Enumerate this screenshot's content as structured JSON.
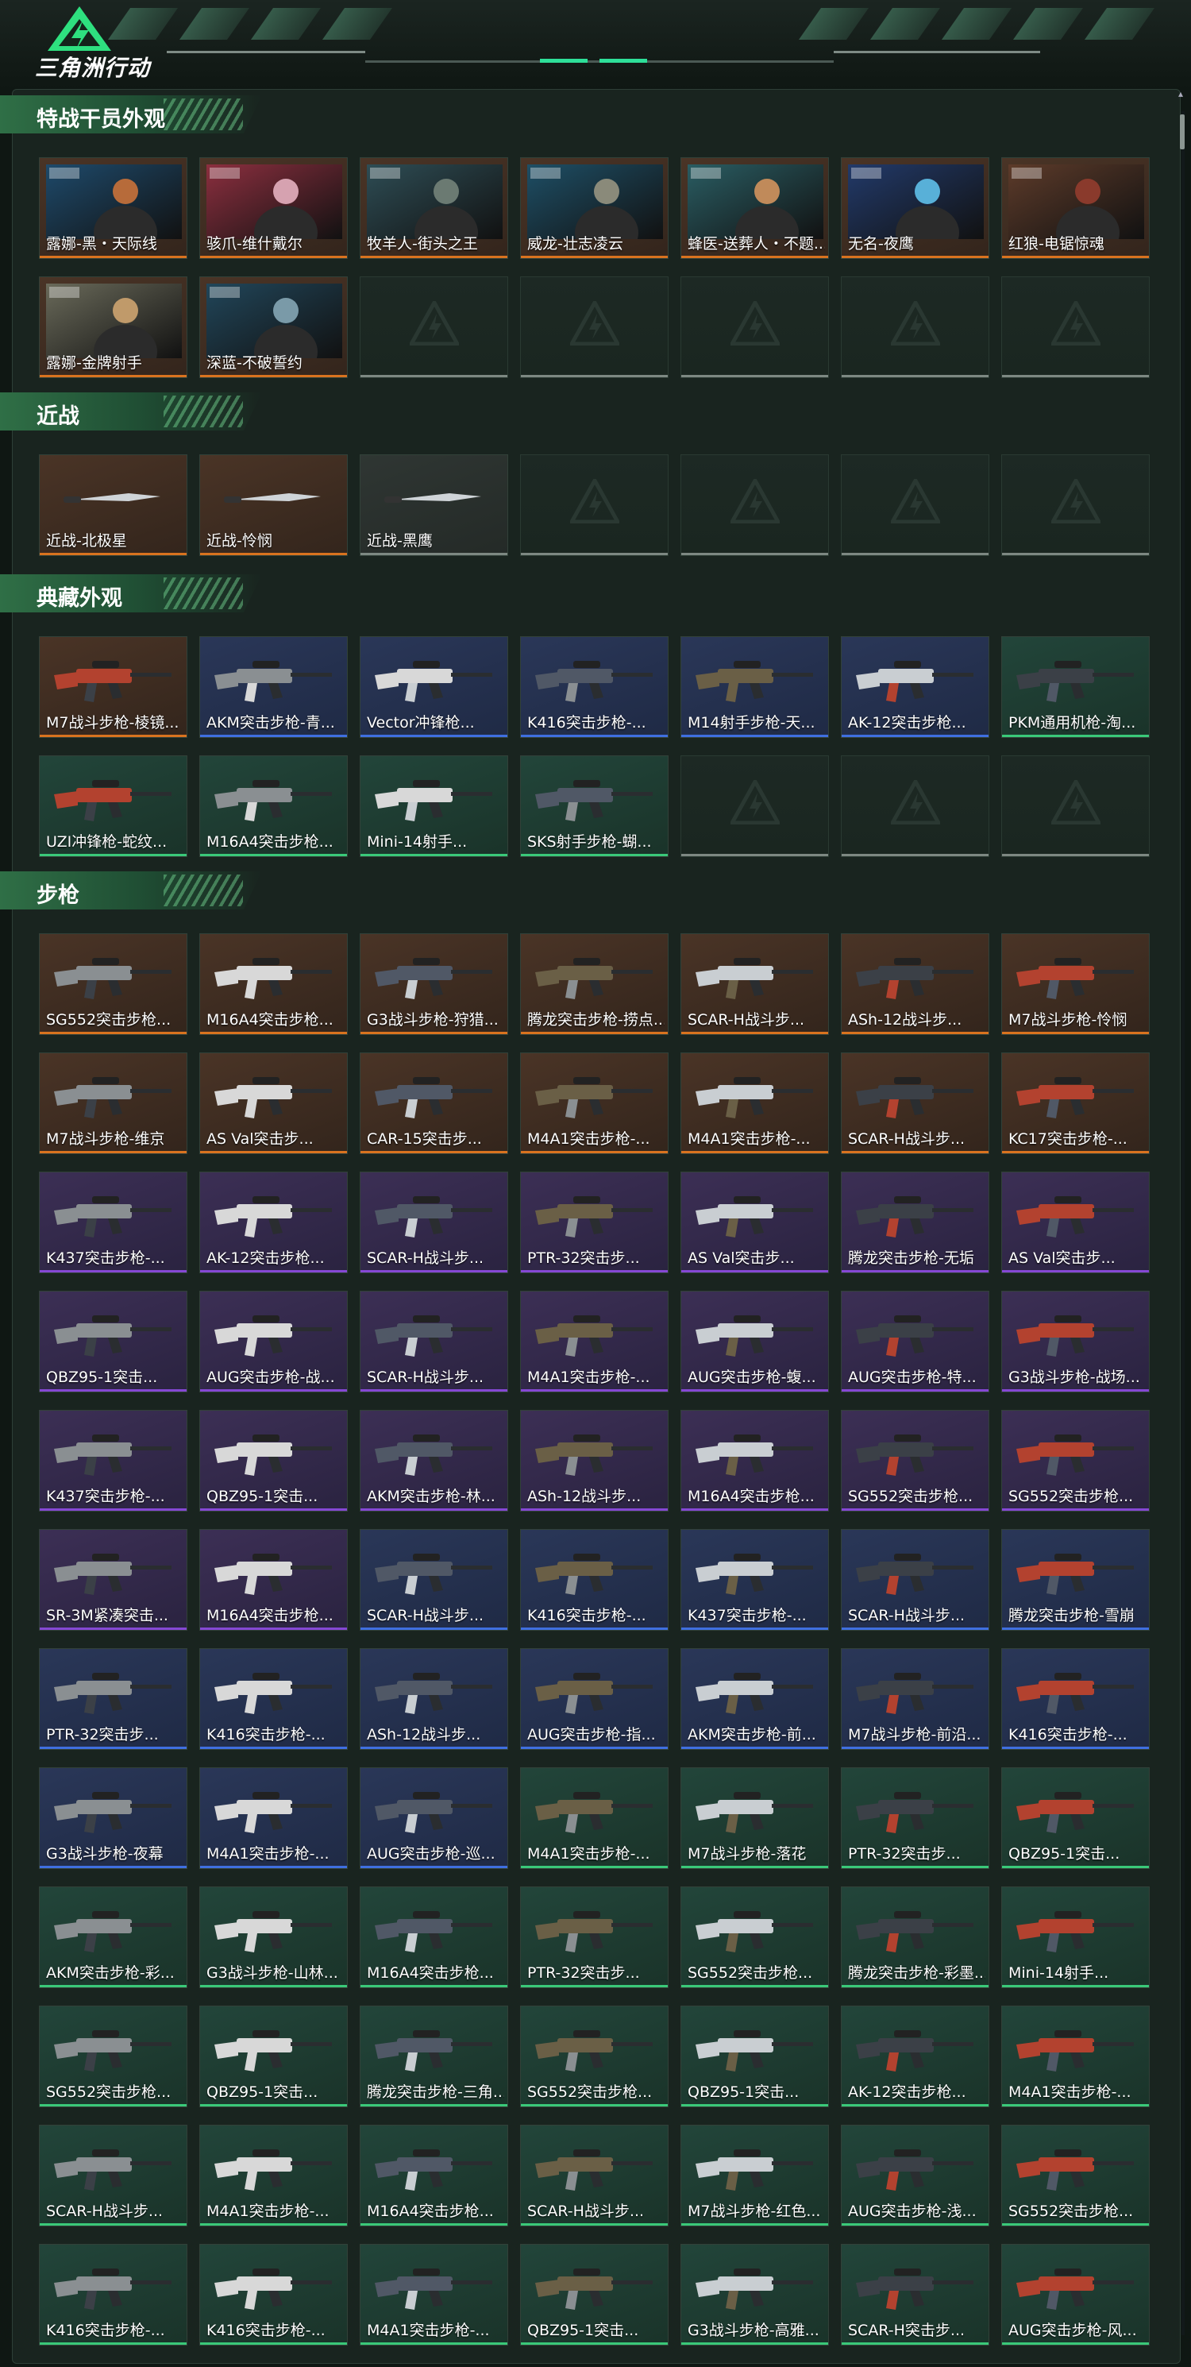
{
  "app": {
    "logo_text": "三角洲行动"
  },
  "colors": {
    "orange": "#d9731f",
    "purple": "#8548d4",
    "blue": "#3f6fe0",
    "green": "#3ac979",
    "grey": "#7d8882"
  },
  "sections": [
    {
      "title": "特战干员外观",
      "items": [
        {
          "name": "露娜-黑・天际线",
          "rarity": "orange",
          "icon": "operator-portrait"
        },
        {
          "name": "骇爪-维什戴尔",
          "rarity": "orange",
          "icon": "operator-portrait"
        },
        {
          "name": "牧羊人-街头之王",
          "rarity": "orange",
          "icon": "operator-portrait"
        },
        {
          "name": "威龙-壮志凌云",
          "rarity": "orange",
          "icon": "operator-portrait"
        },
        {
          "name": "蜂医-送葬人・不题...",
          "rarity": "orange",
          "icon": "operator-portrait"
        },
        {
          "name": "无名-夜鹰",
          "rarity": "orange",
          "icon": "operator-portrait"
        },
        {
          "name": "红狼-电锯惊魂",
          "rarity": "orange",
          "icon": "operator-portrait"
        },
        {
          "name": "露娜-金牌射手",
          "rarity": "orange",
          "icon": "operator-portrait"
        },
        {
          "name": "深蓝-不破誓约",
          "rarity": "orange",
          "icon": "operator-portrait"
        }
      ]
    },
    {
      "title": "近战",
      "items": [
        {
          "name": "近战-北极星",
          "rarity": "orange",
          "icon": "knife"
        },
        {
          "name": "近战-怜悯",
          "rarity": "orange",
          "icon": "knife"
        },
        {
          "name": "近战-黑鹰",
          "rarity": "grey",
          "icon": "knife"
        }
      ]
    },
    {
      "title": "典藏外观",
      "items": [
        {
          "name": "M7战斗步枪-棱镜...",
          "rarity": "orange",
          "icon": "rifle"
        },
        {
          "name": "AKM突击步枪-青...",
          "rarity": "blue",
          "icon": "rifle"
        },
        {
          "name": "Vector冲锋枪...",
          "rarity": "blue",
          "icon": "smg"
        },
        {
          "name": "K416突击步枪-...",
          "rarity": "blue",
          "icon": "rifle"
        },
        {
          "name": "M14射手步枪-天...",
          "rarity": "blue",
          "icon": "rifle"
        },
        {
          "name": "AK-12突击步枪...",
          "rarity": "blue",
          "icon": "rifle"
        },
        {
          "name": "PKM通用机枪-淘...",
          "rarity": "green",
          "icon": "rifle"
        },
        {
          "name": "UZI冲锋枪-蛇纹...",
          "rarity": "green",
          "icon": "smg"
        },
        {
          "name": "M16A4突击步枪...",
          "rarity": "green",
          "icon": "rifle"
        },
        {
          "name": "Mini-14射手...",
          "rarity": "green",
          "icon": "rifle"
        },
        {
          "name": "SKS射手步枪-蝴...",
          "rarity": "green",
          "icon": "rifle"
        }
      ]
    },
    {
      "title": "步枪",
      "items": [
        {
          "name": "SG552突击步枪...",
          "rarity": "orange",
          "icon": "rifle"
        },
        {
          "name": "M16A4突击步枪...",
          "rarity": "orange",
          "icon": "rifle"
        },
        {
          "name": "G3战斗步枪-狩猎...",
          "rarity": "orange",
          "icon": "rifle"
        },
        {
          "name": "腾龙突击步枪-捞点...",
          "rarity": "orange",
          "icon": "rifle"
        },
        {
          "name": "SCAR-H战斗步...",
          "rarity": "orange",
          "icon": "rifle"
        },
        {
          "name": "ASh-12战斗步...",
          "rarity": "orange",
          "icon": "rifle"
        },
        {
          "name": "M7战斗步枪-怜悯",
          "rarity": "orange",
          "icon": "rifle"
        },
        {
          "name": "M7战斗步枪-维京",
          "rarity": "orange",
          "icon": "rifle"
        },
        {
          "name": "AS Val突击步...",
          "rarity": "orange",
          "icon": "rifle"
        },
        {
          "name": "CAR-15突击步...",
          "rarity": "orange",
          "icon": "rifle"
        },
        {
          "name": "M4A1突击步枪-...",
          "rarity": "orange",
          "icon": "rifle"
        },
        {
          "name": "M4A1突击步枪-...",
          "rarity": "orange",
          "icon": "rifle"
        },
        {
          "name": "SCAR-H战斗步...",
          "rarity": "orange",
          "icon": "rifle"
        },
        {
          "name": "KC17突击步枪-...",
          "rarity": "orange",
          "icon": "rifle"
        },
        {
          "name": "K437突击步枪-...",
          "rarity": "purple",
          "icon": "rifle"
        },
        {
          "name": "AK-12突击步枪...",
          "rarity": "purple",
          "icon": "rifle"
        },
        {
          "name": "SCAR-H战斗步...",
          "rarity": "purple",
          "icon": "rifle"
        },
        {
          "name": "PTR-32突击步...",
          "rarity": "purple",
          "icon": "rifle"
        },
        {
          "name": "AS Val突击步...",
          "rarity": "purple",
          "icon": "rifle"
        },
        {
          "name": "腾龙突击步枪-无垢",
          "rarity": "purple",
          "icon": "rifle"
        },
        {
          "name": "AS Val突击步...",
          "rarity": "purple",
          "icon": "rifle"
        },
        {
          "name": "QBZ95-1突击...",
          "rarity": "purple",
          "icon": "rifle"
        },
        {
          "name": "AUG突击步枪-战...",
          "rarity": "purple",
          "icon": "rifle"
        },
        {
          "name": "SCAR-H战斗步...",
          "rarity": "purple",
          "icon": "rifle"
        },
        {
          "name": "M4A1突击步枪-...",
          "rarity": "purple",
          "icon": "rifle"
        },
        {
          "name": "AUG突击步枪-蝮...",
          "rarity": "purple",
          "icon": "rifle"
        },
        {
          "name": "AUG突击步枪-特...",
          "rarity": "purple",
          "icon": "rifle"
        },
        {
          "name": "G3战斗步枪-战场...",
          "rarity": "purple",
          "icon": "rifle"
        },
        {
          "name": "K437突击步枪-...",
          "rarity": "purple",
          "icon": "rifle"
        },
        {
          "name": "QBZ95-1突击...",
          "rarity": "purple",
          "icon": "rifle"
        },
        {
          "name": "AKM突击步枪-林...",
          "rarity": "purple",
          "icon": "rifle"
        },
        {
          "name": "ASh-12战斗步...",
          "rarity": "purple",
          "icon": "rifle"
        },
        {
          "name": "M16A4突击步枪...",
          "rarity": "purple",
          "icon": "rifle"
        },
        {
          "name": "SG552突击步枪...",
          "rarity": "purple",
          "icon": "rifle"
        },
        {
          "name": "SG552突击步枪...",
          "rarity": "purple",
          "icon": "rifle"
        },
        {
          "name": "SR-3M紧凑突击...",
          "rarity": "purple",
          "icon": "rifle"
        },
        {
          "name": "M16A4突击步枪...",
          "rarity": "purple",
          "icon": "rifle"
        },
        {
          "name": "SCAR-H战斗步...",
          "rarity": "blue",
          "icon": "rifle"
        },
        {
          "name": "K416突击步枪-...",
          "rarity": "blue",
          "icon": "rifle"
        },
        {
          "name": "K437突击步枪-...",
          "rarity": "blue",
          "icon": "rifle"
        },
        {
          "name": "SCAR-H战斗步...",
          "rarity": "blue",
          "icon": "rifle"
        },
        {
          "name": "腾龙突击步枪-雪崩",
          "rarity": "blue",
          "icon": "rifle"
        },
        {
          "name": "PTR-32突击步...",
          "rarity": "blue",
          "icon": "rifle"
        },
        {
          "name": "K416突击步枪-...",
          "rarity": "blue",
          "icon": "rifle"
        },
        {
          "name": "ASh-12战斗步...",
          "rarity": "blue",
          "icon": "rifle"
        },
        {
          "name": "AUG突击步枪-指...",
          "rarity": "blue",
          "icon": "rifle"
        },
        {
          "name": "AKM突击步枪-前...",
          "rarity": "blue",
          "icon": "rifle"
        },
        {
          "name": "M7战斗步枪-前沿...",
          "rarity": "blue",
          "icon": "rifle"
        },
        {
          "name": "K416突击步枪-...",
          "rarity": "blue",
          "icon": "rifle"
        },
        {
          "name": "G3战斗步枪-夜幕",
          "rarity": "blue",
          "icon": "rifle"
        },
        {
          "name": "M4A1突击步枪-...",
          "rarity": "blue",
          "icon": "rifle"
        },
        {
          "name": "AUG突击步枪-巡...",
          "rarity": "blue",
          "icon": "rifle"
        },
        {
          "name": "M4A1突击步枪-...",
          "rarity": "green",
          "icon": "rifle"
        },
        {
          "name": "M7战斗步枪-落花",
          "rarity": "green",
          "icon": "rifle"
        },
        {
          "name": "PTR-32突击步...",
          "rarity": "green",
          "icon": "rifle"
        },
        {
          "name": "QBZ95-1突击...",
          "rarity": "green",
          "icon": "rifle"
        },
        {
          "name": "AKM突击步枪-彩...",
          "rarity": "green",
          "icon": "rifle"
        },
        {
          "name": "G3战斗步枪-山林...",
          "rarity": "green",
          "icon": "rifle"
        },
        {
          "name": "M16A4突击步枪...",
          "rarity": "green",
          "icon": "rifle"
        },
        {
          "name": "PTR-32突击步...",
          "rarity": "green",
          "icon": "rifle"
        },
        {
          "name": "SG552突击步枪...",
          "rarity": "green",
          "icon": "rifle"
        },
        {
          "name": "腾龙突击步枪-彩墨...",
          "rarity": "green",
          "icon": "rifle"
        },
        {
          "name": "Mini-14射手...",
          "rarity": "green",
          "icon": "rifle"
        },
        {
          "name": "SG552突击步枪...",
          "rarity": "green",
          "icon": "rifle"
        },
        {
          "name": "QBZ95-1突击...",
          "rarity": "green",
          "icon": "rifle"
        },
        {
          "name": "腾龙突击步枪-三角...",
          "rarity": "green",
          "icon": "rifle"
        },
        {
          "name": "SG552突击步枪...",
          "rarity": "green",
          "icon": "rifle"
        },
        {
          "name": "QBZ95-1突击...",
          "rarity": "green",
          "icon": "rifle"
        },
        {
          "name": "AK-12突击步枪...",
          "rarity": "green",
          "icon": "rifle"
        },
        {
          "name": "M4A1突击步枪-...",
          "rarity": "green",
          "icon": "rifle"
        },
        {
          "name": "SCAR-H战斗步...",
          "rarity": "green",
          "icon": "rifle"
        },
        {
          "name": "M4A1突击步枪-...",
          "rarity": "green",
          "icon": "rifle"
        },
        {
          "name": "M16A4突击步枪...",
          "rarity": "green",
          "icon": "rifle"
        },
        {
          "name": "SCAR-H战斗步...",
          "rarity": "green",
          "icon": "rifle"
        },
        {
          "name": "M7战斗步枪-红色...",
          "rarity": "green",
          "icon": "rifle"
        },
        {
          "name": "AUG突击步枪-浅...",
          "rarity": "green",
          "icon": "rifle"
        },
        {
          "name": "SG552突击步枪...",
          "rarity": "green",
          "icon": "rifle"
        },
        {
          "name": "K416突击步枪-...",
          "rarity": "green",
          "icon": "rifle"
        },
        {
          "name": "K416突击步枪-...",
          "rarity": "green",
          "icon": "rifle"
        },
        {
          "name": "M4A1突击步枪-...",
          "rarity": "green",
          "icon": "rifle"
        },
        {
          "name": "QBZ95-1突击...",
          "rarity": "green",
          "icon": "rifle"
        },
        {
          "name": "G3战斗步枪-高雅...",
          "rarity": "green",
          "icon": "rifle"
        },
        {
          "name": "SCAR-H突击步...",
          "rarity": "green",
          "icon": "rifle"
        },
        {
          "name": "AUG突击步枪-风...",
          "rarity": "green",
          "icon": "rifle"
        }
      ]
    }
  ]
}
